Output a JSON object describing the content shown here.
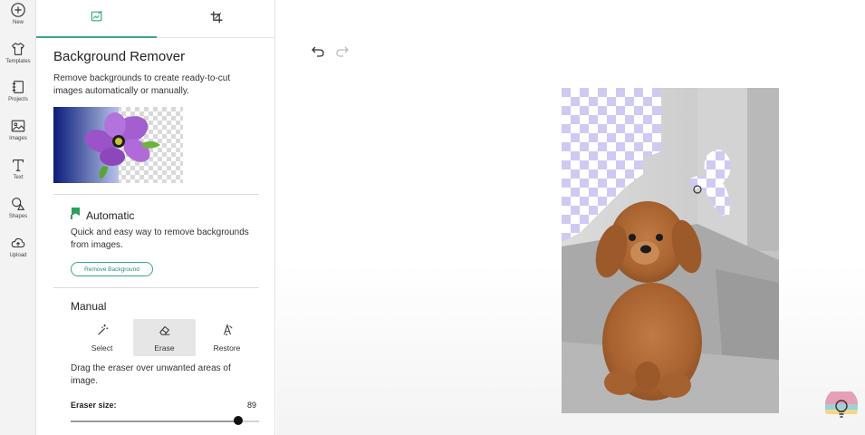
{
  "rail": [
    {
      "label": "New",
      "icon": "plus-circle-icon"
    },
    {
      "label": "Templates",
      "icon": "tshirt-icon"
    },
    {
      "label": "Projects",
      "icon": "notebook-icon"
    },
    {
      "label": "Images",
      "icon": "image-icon"
    },
    {
      "label": "Text",
      "icon": "text-t-icon"
    },
    {
      "label": "Shapes",
      "icon": "shapes-icon"
    },
    {
      "label": "Upload",
      "icon": "cloud-upload-icon"
    }
  ],
  "tabs": [
    {
      "icon": "image-edit-icon",
      "active": true
    },
    {
      "icon": "crop-icon",
      "active": false
    }
  ],
  "panel": {
    "title": "Background Remover",
    "description": "Remove backgrounds to create ready-to-cut images automatically or manually."
  },
  "automatic": {
    "title": "Automatic",
    "description": "Quick and easy way to remove backgrounds from images.",
    "button": "Remove Background"
  },
  "manual": {
    "title": "Manual",
    "tools": [
      {
        "label": "Select",
        "icon": "magic-wand-icon",
        "active": false
      },
      {
        "label": "Erase",
        "icon": "eraser-icon",
        "active": true
      },
      {
        "label": "Restore",
        "icon": "restore-icon",
        "active": false
      }
    ],
    "description": "Drag the eraser over unwanted areas of image.",
    "size_label": "Eraser size:",
    "size_value": "89",
    "size_fraction": 0.89
  },
  "colors": {
    "accent": "#3aa58d",
    "checker_a": "#ffffff",
    "checker_b": "#cfcaf2"
  }
}
